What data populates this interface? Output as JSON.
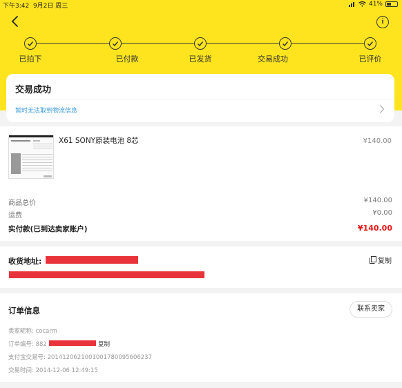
{
  "status_bar": {
    "time": "下午3:42",
    "date": "9月2日 周三",
    "battery": "41%",
    "battery_level": 0.41
  },
  "steps": [
    {
      "label": "已拍下"
    },
    {
      "label": "已付款"
    },
    {
      "label": "已发货"
    },
    {
      "label": "交易成功"
    },
    {
      "label": "已评价"
    }
  ],
  "status_card": {
    "title": "交易成功",
    "logistics_text": "暂时无法取到物流信息"
  },
  "product": {
    "name": "X61  SONY原装电池 8芯",
    "price": "¥140.00"
  },
  "summary": {
    "goods_total_label": "商品总价",
    "goods_total_value": "¥140.00",
    "shipping_label": "运费",
    "shipping_value": "¥0.00",
    "paid_label": "实付款(已到达卖家账户)",
    "paid_value": "¥140.00"
  },
  "address": {
    "label": "收货地址:",
    "copy_label": "复制"
  },
  "order_info": {
    "title": "订单信息",
    "contact_button": "联系卖家",
    "seller_nick": "卖家昵称: cocarm",
    "order_no_prefix": "订单编号: 882",
    "order_copy": "复制",
    "alipay_no": "支付宝交易号: 2014120621001001780095606237",
    "trade_time": "交易时间: 2014-12-06 12:49:15"
  },
  "colors": {
    "brand_yellow": "#fde41f",
    "price_red": "#e5171a",
    "link_blue": "#3a9bd9",
    "redaction": "#e8333a"
  },
  "icons": [
    "back-icon",
    "info-icon",
    "check-icon",
    "chevron-right-icon",
    "copy-icon",
    "wifi-icon",
    "signal-icon",
    "battery-icon"
  ]
}
